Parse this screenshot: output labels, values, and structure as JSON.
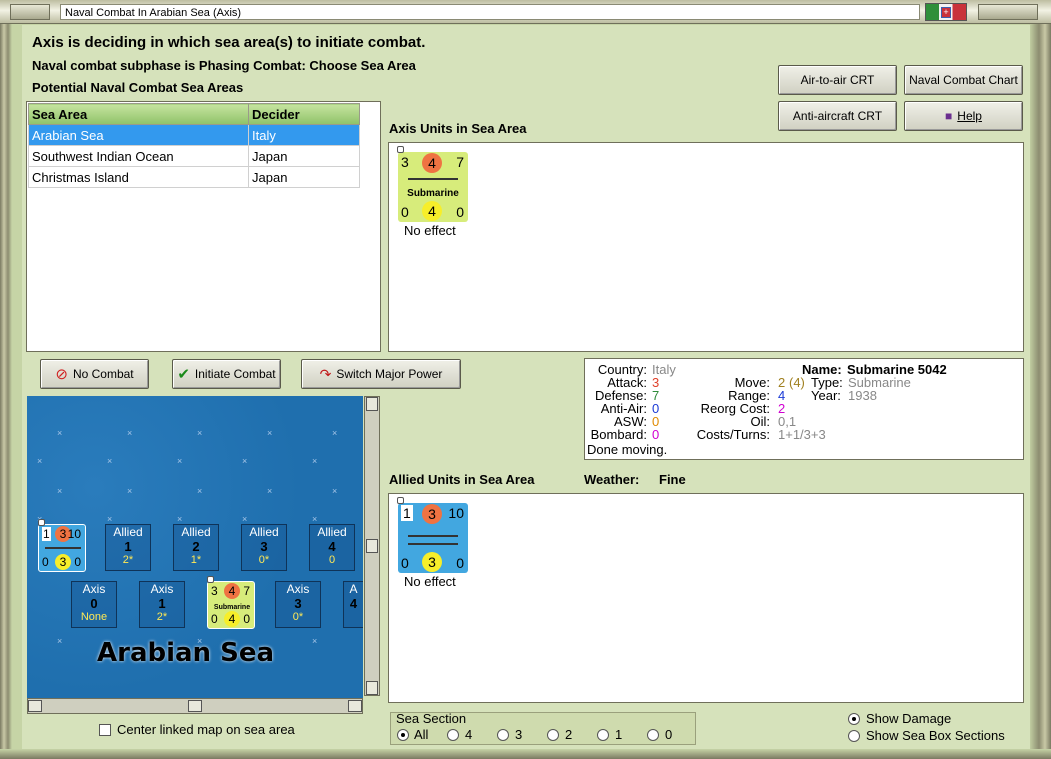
{
  "window": {
    "title": "Naval Combat In Arabian Sea (Axis)"
  },
  "headings": {
    "deciding": "Axis is deciding in which sea area(s) to initiate combat.",
    "subphase": "Naval combat subphase is Phasing Combat: Choose Sea Area",
    "potential": "Potential Naval Combat Sea Areas"
  },
  "toolbar": {
    "air_to_air": "Air-to-air CRT",
    "naval_chart": "Naval Combat Chart",
    "anti_aircraft": "Anti-aircraft CRT",
    "help": "Help"
  },
  "sea_table": {
    "headers": [
      "Sea Area",
      "Decider"
    ],
    "rows": [
      {
        "area": "Arabian Sea",
        "decider": "Italy"
      },
      {
        "area": "Southwest Indian Ocean",
        "decider": "Japan"
      },
      {
        "area": "Christmas Island",
        "decider": "Japan"
      }
    ]
  },
  "axis_units": {
    "label": "Axis Units in Sea Area",
    "unit": {
      "attack": "3",
      "center": "4",
      "range": "7",
      "name": "Submarine",
      "b_left": "0",
      "b_center": "4",
      "b_right": "0"
    },
    "effect": "No effect"
  },
  "actions": {
    "no_combat": "No Combat",
    "initiate": "Initiate Combat",
    "switch": "Switch Major Power"
  },
  "info": {
    "country_label": "Country:",
    "country": "Italy",
    "attack_label": "Attack:",
    "attack": "3",
    "defense_label": "Defense:",
    "defense": "7",
    "aa_label": "Anti-Air:",
    "aa": "0",
    "asw_label": "ASW:",
    "asw": "0",
    "bombard_label": "Bombard:",
    "bombard": "0",
    "done": "Done moving.",
    "name_label": "Name:",
    "name": "Submarine 5042",
    "move_label": "Move:",
    "move": "2",
    "move_paren": "(4)",
    "type_label": "Type:",
    "type": "Submarine",
    "range_label": "Range:",
    "range": "4",
    "year_label": "Year:",
    "year": "1938",
    "reorg_label": "Reorg Cost:",
    "reorg": "2",
    "oil_label": "Oil:",
    "oil": "0,1",
    "costs_label": "Costs/Turns:",
    "costs": "1+1/3+3"
  },
  "allied_units": {
    "label": "Allied Units in Sea Area",
    "weather_label": "Weather:",
    "weather": "Fine",
    "unit": {
      "attack": "1",
      "center": "3",
      "range": "10",
      "b_left": "0",
      "b_center": "3",
      "b_right": "0"
    },
    "effect": "No effect"
  },
  "map": {
    "title": "Arabian Sea",
    "allied_boxes": [
      {
        "label": "Allied",
        "num": "1",
        "sub": "2*"
      },
      {
        "label": "Allied",
        "num": "2",
        "sub": "1*"
      },
      {
        "label": "Allied",
        "num": "3",
        "sub": "0*"
      },
      {
        "label": "Allied",
        "num": "4",
        "sub": "0"
      }
    ],
    "axis_boxes": [
      {
        "label": "Axis",
        "num": "0",
        "sub": "None"
      },
      {
        "label": "Axis",
        "num": "1",
        "sub": "2*"
      },
      {
        "label": "Axis",
        "num": "3",
        "sub": "0*"
      },
      {
        "label": "A",
        "num": "4",
        "sub": ""
      }
    ],
    "mini_allied": {
      "tl": "1",
      "tc": "3",
      "tr": "10",
      "bl": "0",
      "bc": "3",
      "br": "0"
    },
    "mini_axis": {
      "tl": "3",
      "tc": "4",
      "tr": "7",
      "mid": "Submarine",
      "bl": "0",
      "bc": "4",
      "br": "0"
    }
  },
  "options": {
    "center_map": "Center linked map on sea area",
    "sea_section_label": "Sea Section",
    "sections": [
      "All",
      "4",
      "3",
      "2",
      "1",
      "0"
    ],
    "show_damage": "Show Damage",
    "show_sections": "Show Sea Box Sections"
  },
  "colors": {
    "accent_green": "#8fc269",
    "selection_blue": "#3399ee",
    "attack_red": "#e0402a",
    "defense_green": "#2e8b3a",
    "blue_value": "#1a3ad6",
    "orange_value": "#e08a00",
    "magenta_value": "#d100d1",
    "sea_blue": "#1f6fae"
  }
}
